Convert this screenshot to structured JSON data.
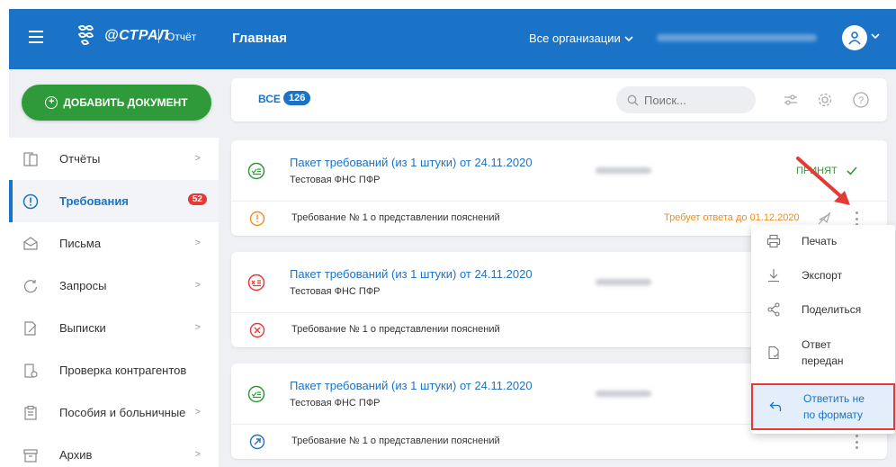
{
  "header": {
    "logo_text": "@СТРАЛ",
    "logo_sub": "Отчёт",
    "page_title": "Главная",
    "org_select": "Все организации"
  },
  "sidebar": {
    "add_button": "ДОБАВИТЬ ДОКУМЕНТ",
    "items": [
      {
        "label": "Отчёты"
      },
      {
        "label": "Требования",
        "badge": "52"
      },
      {
        "label": "Письма"
      },
      {
        "label": "Запросы"
      },
      {
        "label": "Выписки"
      },
      {
        "label": "Проверка контрагентов"
      },
      {
        "label": "Пособия и больничные"
      },
      {
        "label": "Архив"
      }
    ]
  },
  "toolbar": {
    "tab_all": "ВСЕ",
    "tab_count": "126",
    "search_placeholder": "Поиск..."
  },
  "cards": [
    {
      "title": "Пакет требований (из 1 штуки) от 24.11.2020",
      "subtitle": "Тестовая ФНС ПФР",
      "status": "ПРИНЯТ",
      "item": "Требование № 1 о представлении пояснений",
      "due": "Требует ответа до 01.12.2020"
    },
    {
      "title": "Пакет требований (из 1 штуки) от 24.11.2020",
      "subtitle": "Тестовая ФНС ПФР",
      "item": "Требование № 1 о представлении пояснений"
    },
    {
      "title": "Пакет требований (из 1 штуки) от 24.11.2020",
      "subtitle": "Тестовая ФНС ПФР",
      "item": "Требование № 1 о представлении пояснений"
    }
  ],
  "dropdown": {
    "print": "Печать",
    "export": "Экспорт",
    "share": "Поделиться",
    "answer_sent_1": "Ответ",
    "answer_sent_2": "передан",
    "reply_nonformat_1": "Ответить не",
    "reply_nonformat_2": "по формату"
  },
  "colors": {
    "brand": "#1a73c7",
    "green": "#2e9a3a",
    "red": "#e53935",
    "orange": "#f08c1c"
  }
}
